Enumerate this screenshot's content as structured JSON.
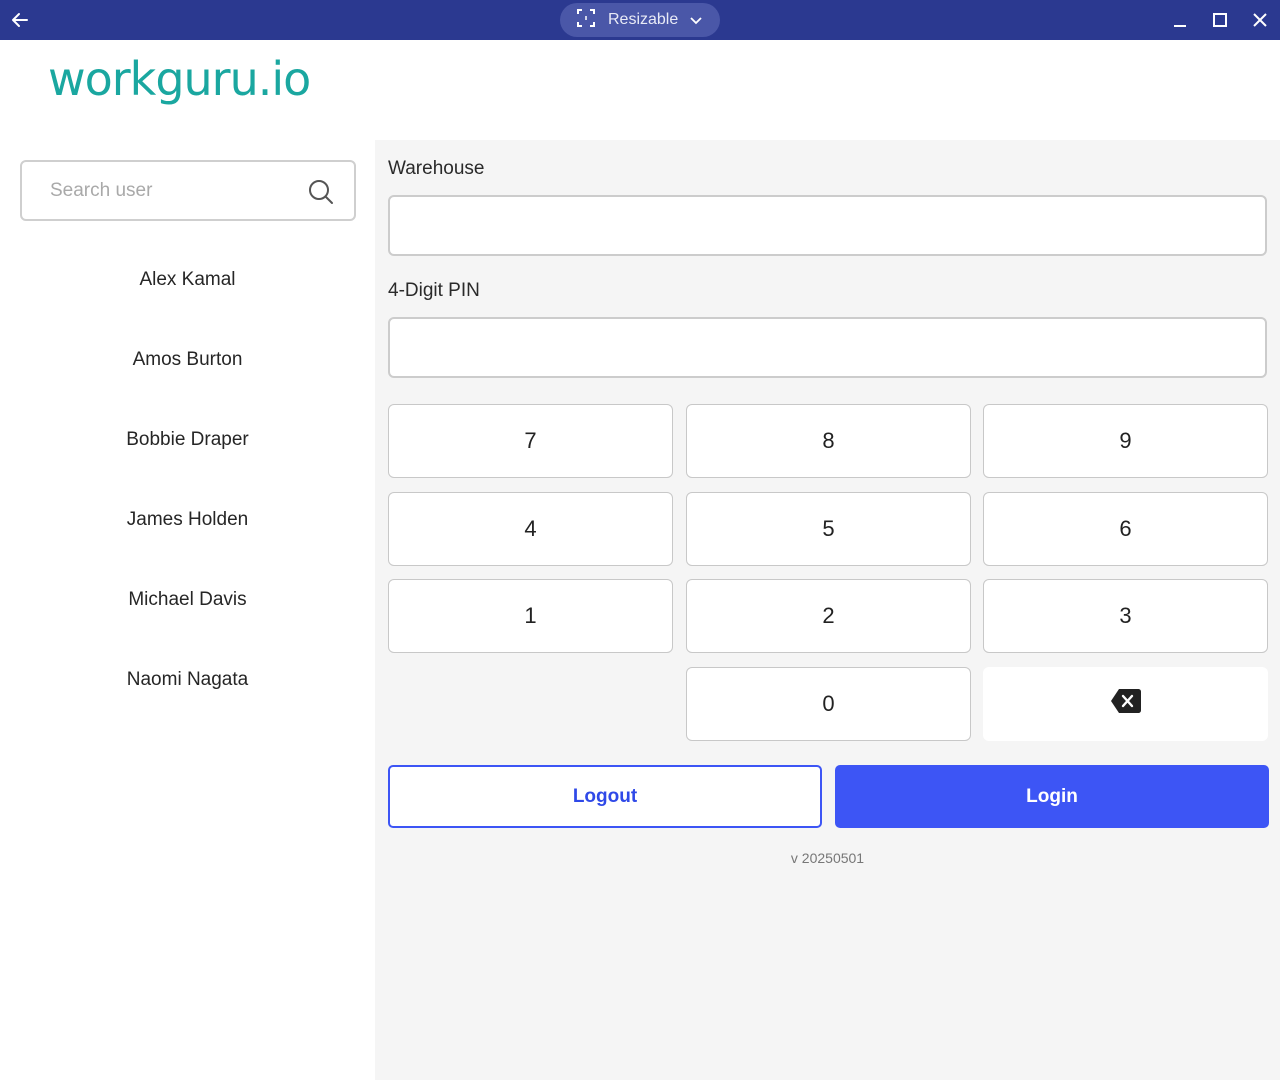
{
  "window": {
    "mode_label": "Resizable",
    "icons": [
      "back-arrow-icon",
      "resize-icon",
      "chevron-down-icon",
      "minimize-icon",
      "maximize-icon",
      "close-icon"
    ]
  },
  "logo": {
    "text": "workguru.io",
    "color": "#1aa7a0"
  },
  "search": {
    "placeholder": "Search user",
    "value": ""
  },
  "users": [
    "Alex Kamal",
    "Amos Burton",
    "Bobbie Draper",
    "James Holden",
    "Michael Davis",
    "Naomi Nagata"
  ],
  "form": {
    "warehouse_label": "Warehouse",
    "warehouse_value": "",
    "pin_label": "4-Digit PIN",
    "pin_value": ""
  },
  "keypad": {
    "k7": "7",
    "k8": "8",
    "k9": "9",
    "k4": "4",
    "k5": "5",
    "k6": "6",
    "k1": "1",
    "k2": "2",
    "k3": "3",
    "k0": "0"
  },
  "actions": {
    "logout_label": "Logout",
    "login_label": "Login"
  },
  "version": "v 20250501",
  "colors": {
    "titlebar": "#2b3990",
    "accent": "#3d55f5",
    "panel_bg": "#f5f5f5"
  }
}
